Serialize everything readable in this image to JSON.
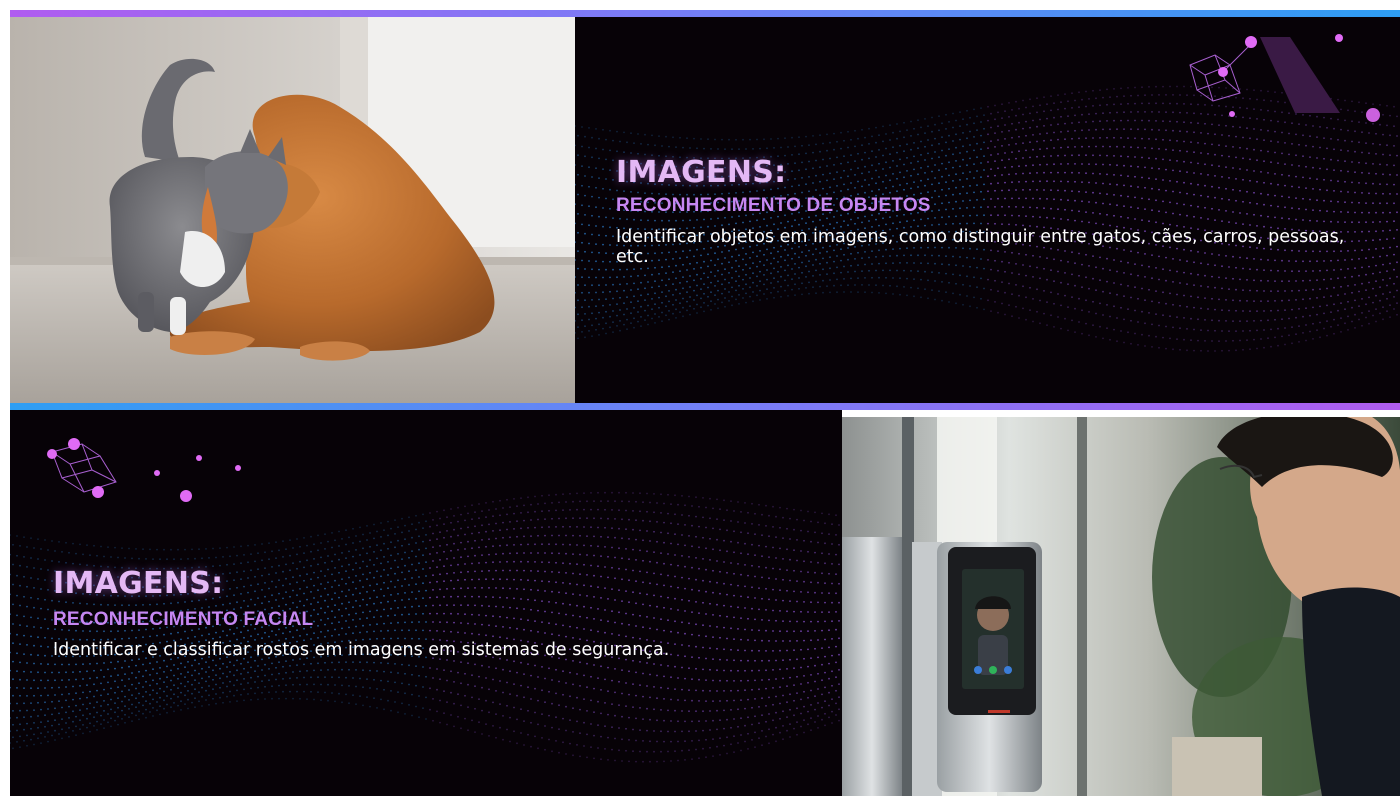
{
  "slide_top": {
    "title": "IMAGENS:",
    "subtitle": "RECONHECIMENTO DE OBJETOS",
    "description": "Identificar objetos em imagens, como distinguir entre gatos, cães, carros, pessoas, etc."
  },
  "slide_bottom": {
    "title": "IMAGENS:",
    "subtitle": "RECONHECIMENTO FACIAL",
    "description": "Identificar e classificar rostos em imagens em sistemas de segurança."
  },
  "colors": {
    "panel_background": "#070207",
    "title": "#e4b8f5",
    "subtitle": "#c687f2",
    "description": "#ffffff",
    "accent_purple": "#b05cf0",
    "accent_blue": "#2e9ef3"
  }
}
